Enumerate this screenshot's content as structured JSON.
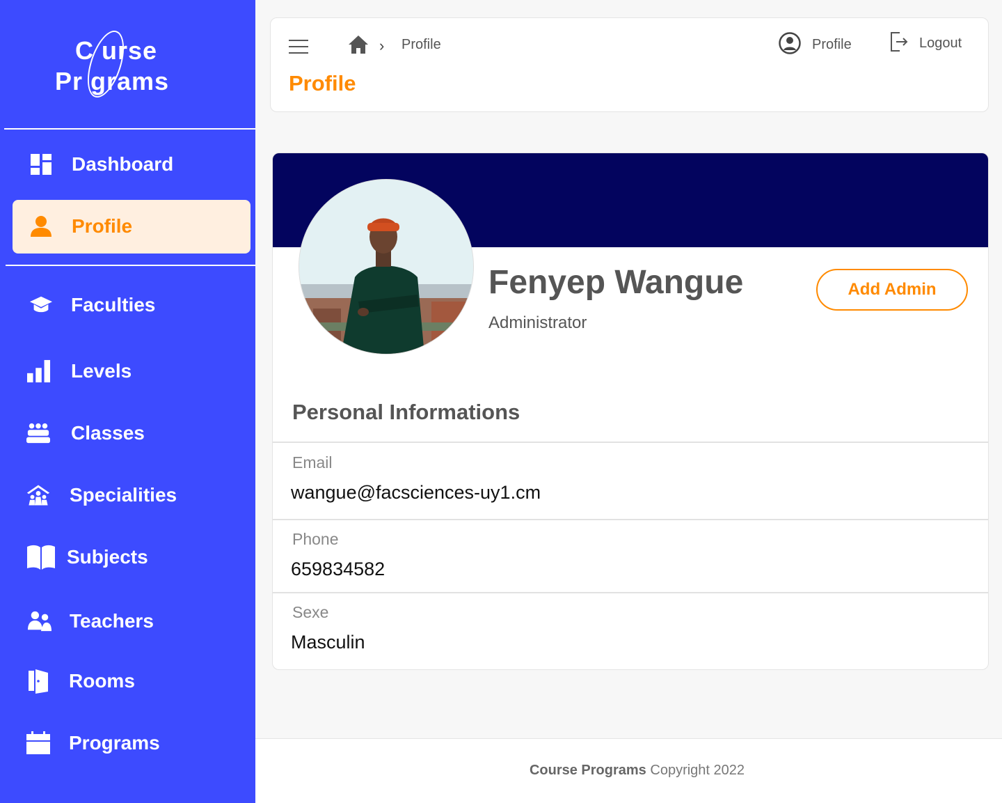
{
  "sidebar": {
    "logo": {
      "line1": "C  urse",
      "line2": "Pr   grams"
    },
    "items": [
      {
        "label": "Dashboard",
        "icon": "dashboard-icon"
      },
      {
        "label": "Profile",
        "icon": "user-icon",
        "active": true
      },
      {
        "label": "Faculties",
        "icon": "graduation-cap-icon"
      },
      {
        "label": "Levels",
        "icon": "bar-chart-icon"
      },
      {
        "label": "Classes",
        "icon": "people-group-icon"
      },
      {
        "label": "Specialities",
        "icon": "school-icon"
      },
      {
        "label": "Subjects",
        "icon": "book-icon"
      },
      {
        "label": "Teachers",
        "icon": "teachers-icon"
      },
      {
        "label": "Rooms",
        "icon": "door-icon"
      },
      {
        "label": "Programs",
        "icon": "calendar-icon"
      }
    ]
  },
  "header": {
    "breadcrumb": {
      "current": "Profile"
    },
    "title": "Profile",
    "profile_label": "Profile",
    "logout_label": "Logout"
  },
  "profile": {
    "name": "Fenyep Wangue",
    "role": "Administrator",
    "add_admin_label": "Add Admin",
    "section_title": "Personal Informations",
    "fields": [
      {
        "label": "Email",
        "value": "wangue@facsciences-uy1.cm"
      },
      {
        "label": "Phone",
        "value": "659834582"
      },
      {
        "label": "Sexe",
        "value": "Masculin"
      }
    ]
  },
  "footer": {
    "brand": "Course Programs",
    "copyright": "Copyright 2022"
  },
  "colors": {
    "sidebar": "#3d4bff",
    "accent": "#ff8a00",
    "banner": "#03045e",
    "active_bg": "#ffefe0"
  }
}
